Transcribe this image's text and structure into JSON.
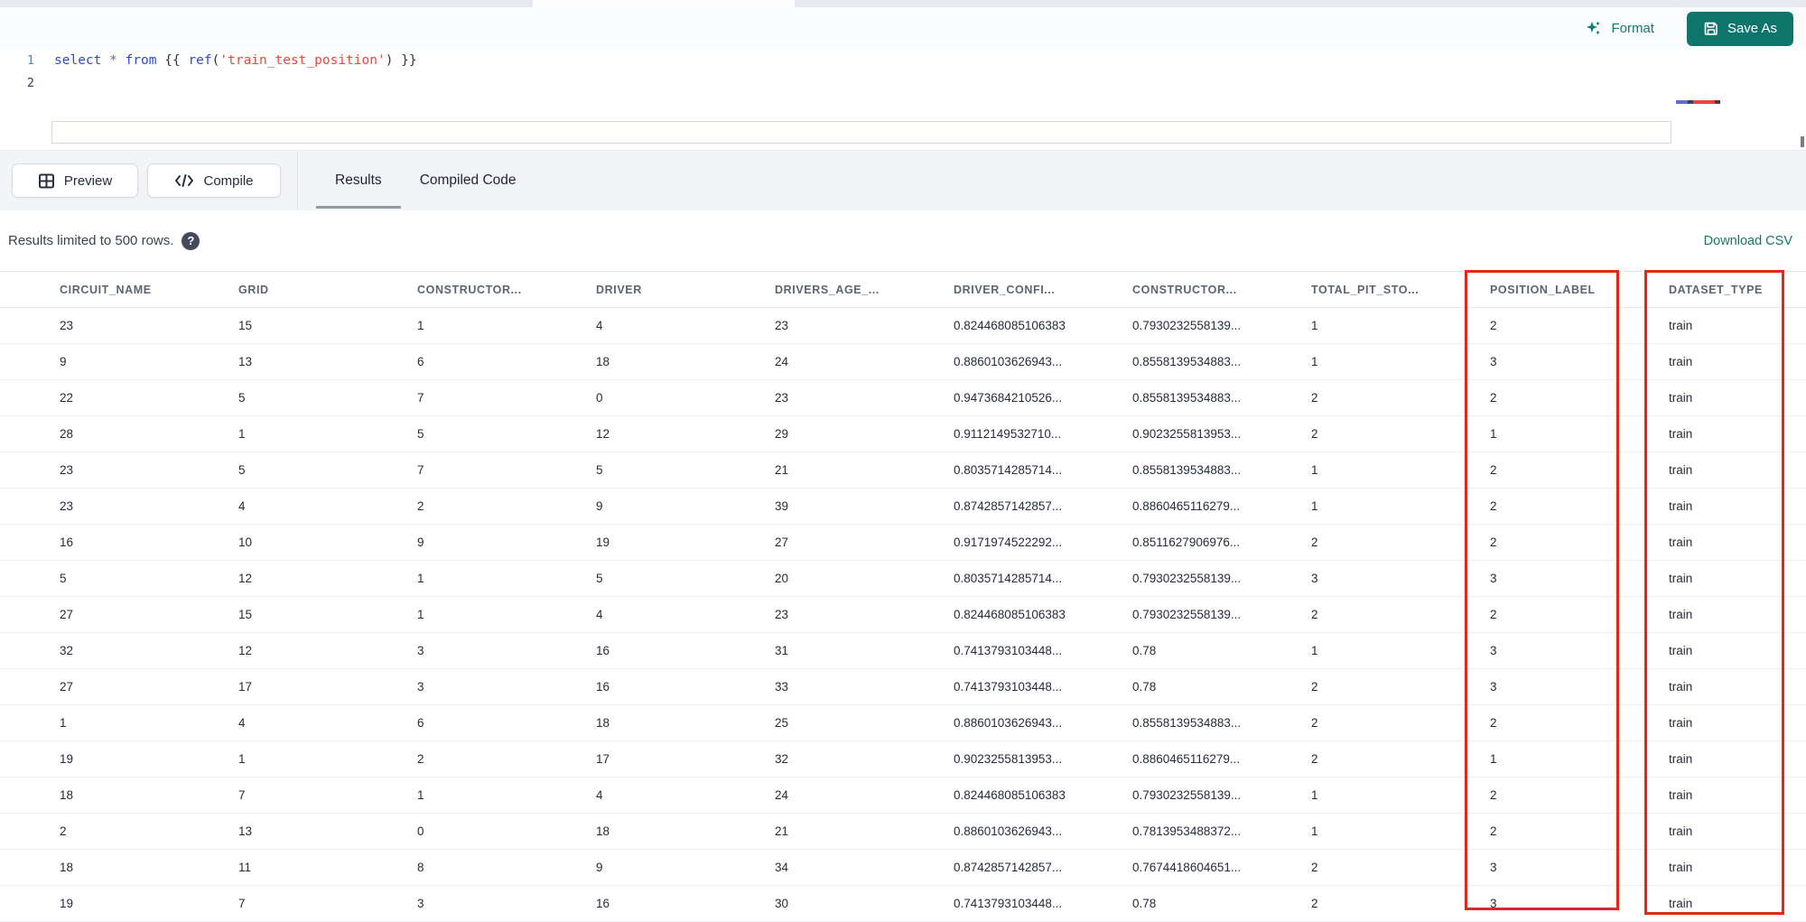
{
  "toolbar": {
    "format_label": "Format",
    "save_as_label": "Save As"
  },
  "editor": {
    "lines": [
      {
        "number": "1",
        "tokens": [
          {
            "text": "select ",
            "type": "kw"
          },
          {
            "text": "* ",
            "type": "op"
          },
          {
            "text": "from ",
            "type": "kw"
          },
          {
            "text": "{{ ",
            "type": "punct"
          },
          {
            "text": "ref",
            "type": "fn"
          },
          {
            "text": "(",
            "type": "punct"
          },
          {
            "text": "'train_test_position'",
            "type": "str"
          },
          {
            "text": ") ",
            "type": "punct"
          },
          {
            "text": "}}",
            "type": "punct"
          }
        ]
      },
      {
        "number": "2",
        "tokens": []
      }
    ]
  },
  "result_toolbar": {
    "preview_label": "Preview",
    "compile_label": "Compile"
  },
  "result_tabs": [
    {
      "label": "Results",
      "active": true
    },
    {
      "label": "Compiled Code",
      "active": false
    }
  ],
  "status": {
    "message": "Results limited to 500 rows.",
    "download_label": "Download CSV"
  },
  "table": {
    "columns": [
      "CIRCUIT_NAME",
      "GRID",
      "CONSTRUCTOR...",
      "DRIVER",
      "DRIVERS_AGE_...",
      "DRIVER_CONFI...",
      "CONSTRUCTOR...",
      "TOTAL_PIT_STO...",
      "POSITION_LABEL",
      "DATASET_TYPE"
    ],
    "rows": [
      [
        "23",
        "15",
        "1",
        "4",
        "23",
        "0.824468085106383",
        "0.7930232558139...",
        "1",
        "2",
        "train"
      ],
      [
        "9",
        "13",
        "6",
        "18",
        "24",
        "0.8860103626943...",
        "0.8558139534883...",
        "1",
        "3",
        "train"
      ],
      [
        "22",
        "5",
        "7",
        "0",
        "23",
        "0.9473684210526...",
        "0.8558139534883...",
        "2",
        "2",
        "train"
      ],
      [
        "28",
        "1",
        "5",
        "12",
        "29",
        "0.9112149532710...",
        "0.9023255813953...",
        "2",
        "1",
        "train"
      ],
      [
        "23",
        "5",
        "7",
        "5",
        "21",
        "0.8035714285714...",
        "0.8558139534883...",
        "1",
        "2",
        "train"
      ],
      [
        "23",
        "4",
        "2",
        "9",
        "39",
        "0.8742857142857...",
        "0.8860465116279...",
        "1",
        "2",
        "train"
      ],
      [
        "16",
        "10",
        "9",
        "19",
        "27",
        "0.9171974522292...",
        "0.8511627906976...",
        "2",
        "2",
        "train"
      ],
      [
        "5",
        "12",
        "1",
        "5",
        "20",
        "0.8035714285714...",
        "0.7930232558139...",
        "3",
        "3",
        "train"
      ],
      [
        "27",
        "15",
        "1",
        "4",
        "23",
        "0.824468085106383",
        "0.7930232558139...",
        "2",
        "2",
        "train"
      ],
      [
        "32",
        "12",
        "3",
        "16",
        "31",
        "0.7413793103448...",
        "0.78",
        "1",
        "3",
        "train"
      ],
      [
        "27",
        "17",
        "3",
        "16",
        "33",
        "0.7413793103448...",
        "0.78",
        "2",
        "3",
        "train"
      ],
      [
        "1",
        "4",
        "6",
        "18",
        "25",
        "0.8860103626943...",
        "0.8558139534883...",
        "2",
        "2",
        "train"
      ],
      [
        "19",
        "1",
        "2",
        "17",
        "32",
        "0.9023255813953...",
        "0.8860465116279...",
        "2",
        "1",
        "train"
      ],
      [
        "18",
        "7",
        "1",
        "4",
        "24",
        "0.824468085106383",
        "0.7930232558139...",
        "1",
        "2",
        "train"
      ],
      [
        "2",
        "13",
        "0",
        "18",
        "21",
        "0.8860103626943...",
        "0.7813953488372...",
        "1",
        "2",
        "train"
      ],
      [
        "18",
        "11",
        "8",
        "9",
        "34",
        "0.8742857142857...",
        "0.7674418604651...",
        "2",
        "3",
        "train"
      ],
      [
        "19",
        "7",
        "3",
        "16",
        "30",
        "0.7413793103448...",
        "0.78",
        "2",
        "3",
        "train"
      ]
    ],
    "highlighted_columns": [
      "POSITION_LABEL",
      "DATASET_TYPE"
    ]
  },
  "colors": {
    "accent_teal": "#0f756c",
    "annotation_red": "#e8251b",
    "keyword_blue": "#2d49c7",
    "string_red": "#e8483b"
  }
}
